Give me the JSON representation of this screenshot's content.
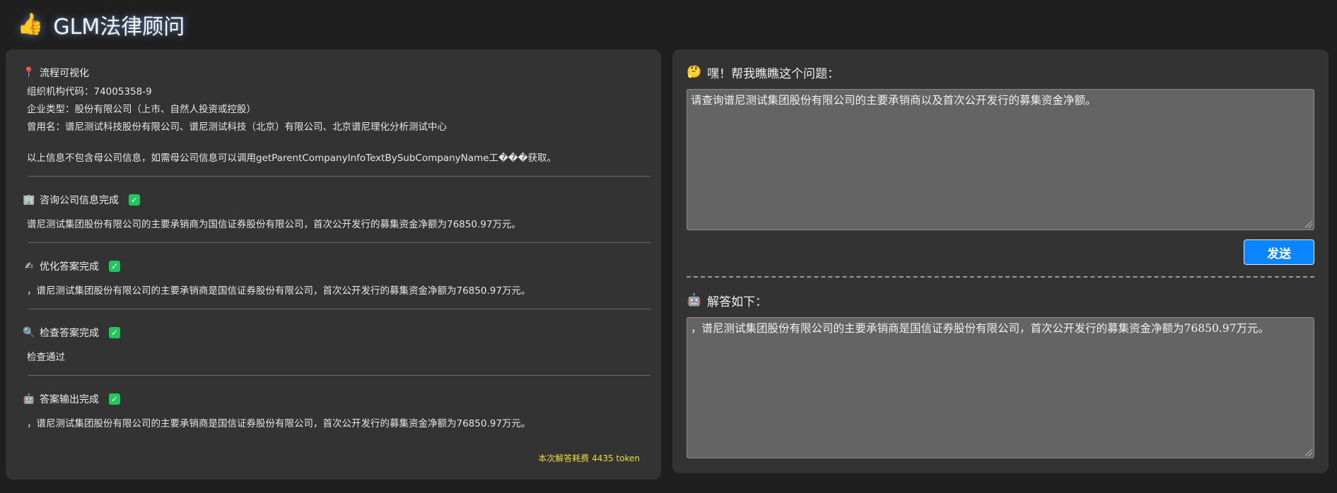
{
  "app": {
    "logo_icon": "thumbs-up-icon",
    "logo_glyph": "👍",
    "title": "GLM法律顾问"
  },
  "left": {
    "header": {
      "icon": "pin-icon",
      "glyph": "📍",
      "label": "流程可视化"
    },
    "info": [
      "组织机构代码：74005358-9",
      "企业类型：股份有限公司（上市、自然人投资或控股）",
      "曾用名：谱尼测试科技股份有限公司、谱尼测试科技（北京）有限公司、北京谱尼理化分析测试中心"
    ],
    "note": "以上信息不包含母公司信息，如需母公司信息可以调用getParentCompanyInfoTextBySubCompanyName工���获取。",
    "steps": [
      {
        "icon": "building-icon",
        "glyph": "🏢",
        "label": "咨询公司信息完成",
        "body": "谱尼测试集团股份有限公司的主要承销商为国信证券股份有限公司，首次公开发行的募集资金净额为76850.97万元。"
      },
      {
        "icon": "writing-hand-icon",
        "glyph": "✍",
        "label": "优化答案完成",
        "body": "，谱尼测试集团股份有限公司的主要承销商是国信证券股份有限公司，首次公开发行的募集资金净额为76850.97万元。"
      },
      {
        "icon": "magnifier-icon",
        "glyph": "🔍",
        "label": "检查答案完成",
        "body": "检查通过"
      },
      {
        "icon": "robot-icon",
        "glyph": "🤖",
        "label": "答案输出完成",
        "body": "，谱尼测试集团股份有限公司的主要承销商是国信证券股份有限公司，首次公开发行的募集资金净额为76850.97万元。"
      }
    ],
    "check_glyph": "✓",
    "cost": "本次解答耗费 4435 token"
  },
  "right": {
    "question_icon": "thinking-face-icon",
    "question_glyph": "🤔",
    "question_label": "嘿！帮我瞧瞧这个问题：",
    "question_value": "请查询谱尼测试集团股份有限公司的主要承销商以及首次公开发行的募集资金净额。",
    "send_label": "发送",
    "answer_icon": "robot-icon",
    "answer_glyph": "🤖",
    "answer_label": "解答如下：",
    "answer_value": "，谱尼测试集团股份有限公司的主要承销商是国信证券股份有限公司，首次公开发行的募集资金净额为76850.97万元。"
  },
  "colors": {
    "background": "#1f1f1f",
    "panel": "#333333",
    "accent": "#0b84ff",
    "success": "#22c55e",
    "cost_text": "#eedd3b"
  }
}
